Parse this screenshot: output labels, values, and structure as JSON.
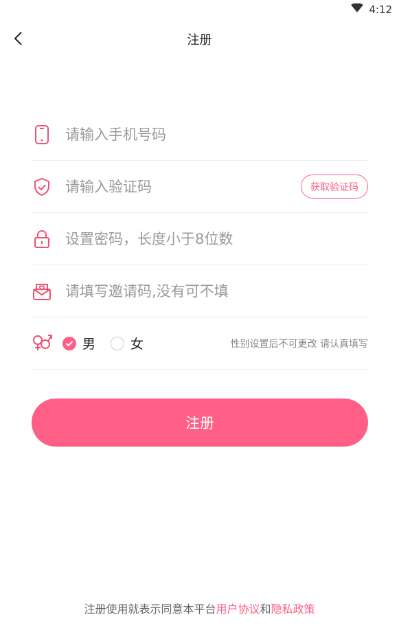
{
  "status_bar": {
    "time": "4:12",
    "icons": [
      "wifi-icon"
    ]
  },
  "nav": {
    "title": "注册",
    "back_icon": "chevron-left-icon"
  },
  "form": {
    "phone": {
      "placeholder": "请输入手机号码",
      "value": "",
      "icon": "phone-icon"
    },
    "code": {
      "placeholder": "请输入验证码",
      "value": "",
      "icon": "shield-check-icon",
      "button_label": "获取验证码"
    },
    "password": {
      "placeholder": "设置密码，长度小于8位数",
      "value": "",
      "icon": "lock-icon"
    },
    "invite": {
      "placeholder": "请填写邀请码,没有可不填",
      "value": "",
      "icon": "envelope-heart-icon"
    },
    "gender": {
      "icon": "gender-icon",
      "options": [
        {
          "label": "男",
          "selected": true
        },
        {
          "label": "女",
          "selected": false
        }
      ],
      "note": "性别设置后不可更改 请认真填写"
    }
  },
  "submit_label": "注册",
  "footer": {
    "prefix": "注册使用就表示同意本平台",
    "user_agreement": "用户协议",
    "conjunction": "和",
    "privacy_policy": "隐私政策"
  },
  "colors": {
    "accent": "#ff5f86",
    "icon": "#ef5270",
    "placeholder": "#9a9a9a",
    "divider": "#eeeeee"
  }
}
